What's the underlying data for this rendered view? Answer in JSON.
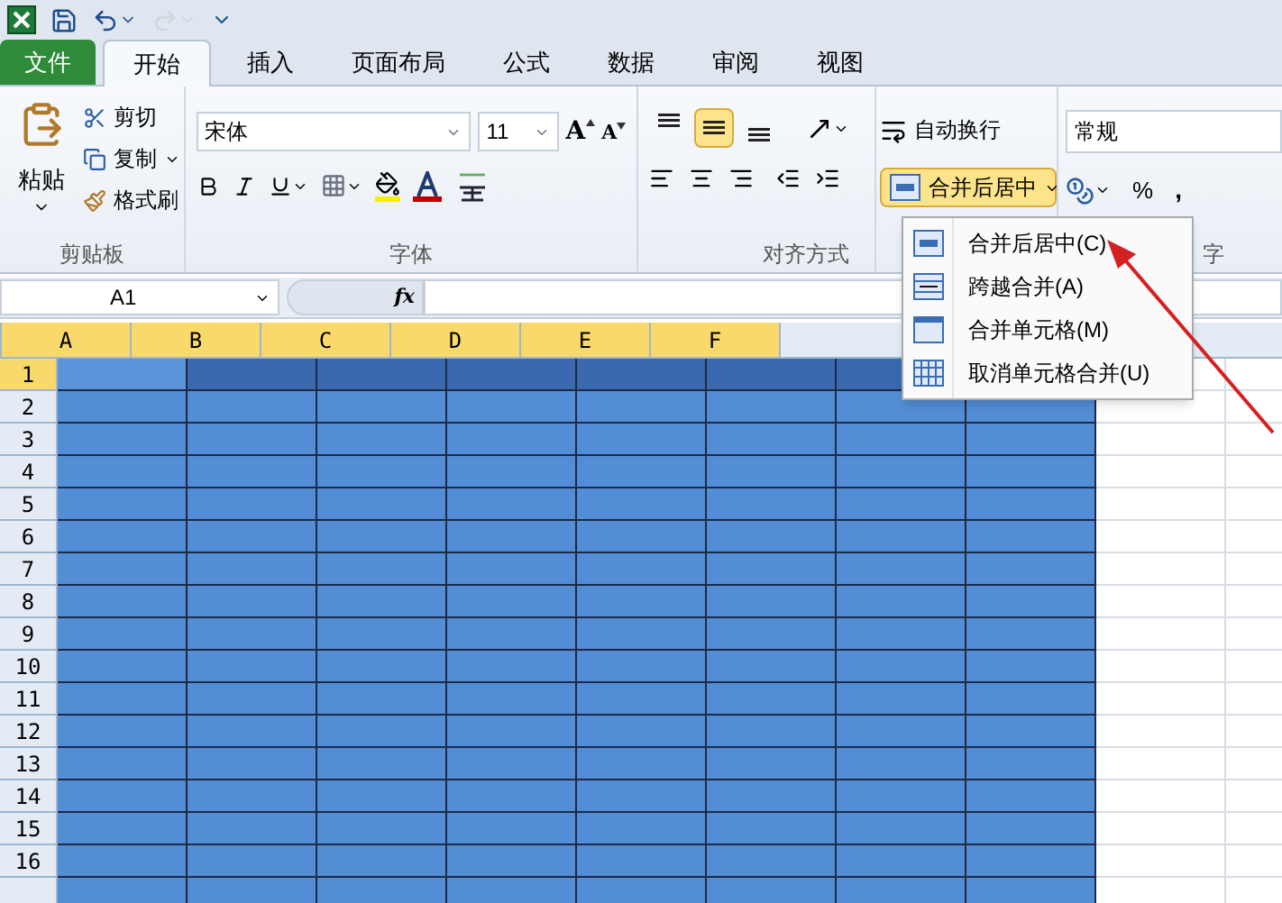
{
  "quick_access": [
    {
      "kind": "save",
      "disabled": false
    },
    {
      "kind": "undo",
      "disabled": false
    },
    {
      "kind": "redo",
      "disabled": true
    },
    {
      "kind": "customize",
      "disabled": false
    }
  ],
  "tabs": [
    {
      "label": "文件",
      "kind": "file",
      "selected": false
    },
    {
      "label": "开始",
      "kind": "tab",
      "selected": true
    },
    {
      "label": "插入",
      "kind": "tab",
      "selected": false
    },
    {
      "label": "页面布局",
      "kind": "tab",
      "selected": false
    },
    {
      "label": "公式",
      "kind": "tab",
      "selected": false
    },
    {
      "label": "数据",
      "kind": "tab",
      "selected": false
    },
    {
      "label": "审阅",
      "kind": "tab",
      "selected": false
    },
    {
      "label": "视图",
      "kind": "tab",
      "selected": false
    }
  ],
  "clipboard": {
    "paste": "粘贴",
    "cut": "剪切",
    "copy": "复制",
    "format_painter": "格式刷",
    "label": "剪贴板"
  },
  "font": {
    "font_name": "宋体",
    "font_size": "11",
    "grow_font": "A",
    "shrink_font": "A",
    "label": "字体"
  },
  "alignment": {
    "vertical": [
      {
        "kind": "top",
        "selected": false
      },
      {
        "kind": "middle",
        "selected": true
      },
      {
        "kind": "bottom",
        "selected": false
      }
    ],
    "wrap_text": "自动换行",
    "merge_center": {
      "label": "合并后居中",
      "open": true
    },
    "label": "对齐方式"
  },
  "number": {
    "format": "常规",
    "percent": "%",
    "comma": ",",
    "label": "字"
  },
  "formula_bar": {
    "name_box": "A1",
    "fx": "fx"
  },
  "merge_menu": [
    {
      "label": "合并后居中(C)",
      "kind": "merge-center"
    },
    {
      "label": "跨越合并(A)",
      "kind": "merge-across"
    },
    {
      "label": "合并单元格(M)",
      "kind": "merge"
    },
    {
      "label": "取消单元格合并(U)",
      "kind": "unmerge"
    }
  ],
  "sheet": {
    "columns": [
      {
        "label": "A",
        "selected": true
      },
      {
        "label": "B",
        "selected": true
      },
      {
        "label": "C",
        "selected": true
      },
      {
        "label": "D",
        "selected": true
      },
      {
        "label": "E",
        "selected": true
      },
      {
        "label": "F",
        "selected": true
      }
    ],
    "rows": [
      {
        "label": "1",
        "selected": true
      },
      {
        "label": "2",
        "selected": false
      },
      {
        "label": "3",
        "selected": false
      },
      {
        "label": "4",
        "selected": false
      },
      {
        "label": "5",
        "selected": false
      },
      {
        "label": "6",
        "selected": false
      },
      {
        "label": "7",
        "selected": false
      },
      {
        "label": "8",
        "selected": false
      },
      {
        "label": "9",
        "selected": false
      },
      {
        "label": "10",
        "selected": false
      },
      {
        "label": "11",
        "selected": false
      },
      {
        "label": "12",
        "selected": false
      },
      {
        "label": "13",
        "selected": false
      },
      {
        "label": "14",
        "selected": false
      },
      {
        "label": "15",
        "selected": false
      },
      {
        "label": "16",
        "selected": false
      }
    ]
  }
}
